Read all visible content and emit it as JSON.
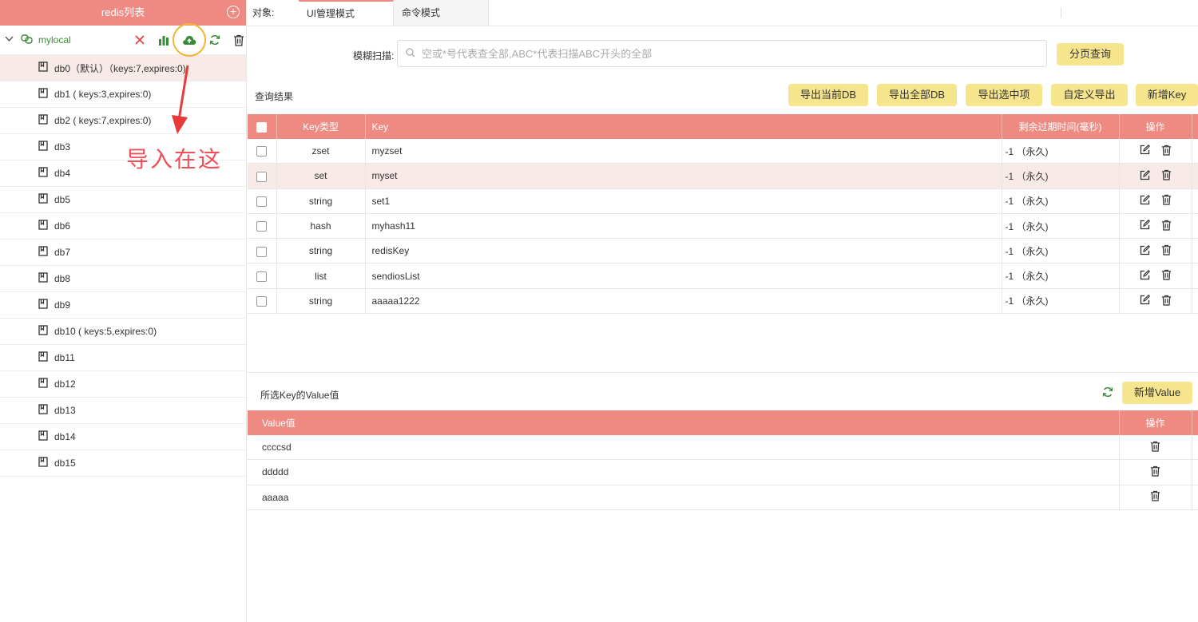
{
  "sidebar": {
    "title": "redis列表",
    "connection": {
      "name": "mylocal"
    },
    "annotation": "导入在这",
    "databases": [
      "db0（默认）（keys:7,expires:0)",
      "db1 ( keys:3,expires:0)",
      "db2 ( keys:7,expires:0)",
      "db3",
      "db4",
      "db5",
      "db6",
      "db7",
      "db8",
      "db9",
      "db10 ( keys:5,expires:0)",
      "db11",
      "db12",
      "db13",
      "db14",
      "db15"
    ]
  },
  "header": {
    "object_label": "对象:",
    "tabs": [
      "UI管理模式",
      "命令模式"
    ]
  },
  "search": {
    "label": "模糊扫描:",
    "placeholder": "空或*号代表查全部,ABC*代表扫描ABC开头的全部",
    "button": "分页查询"
  },
  "results": {
    "title": "查询结果",
    "buttons": [
      "导出当前DB",
      "导出全部DB",
      "导出选中项",
      "自定义导出",
      "新增Key"
    ],
    "columns": [
      "Key类型",
      "Key",
      "剩余过期时间(毫秒)",
      "操作"
    ],
    "rows": [
      {
        "type": "zset",
        "key": "myzset",
        "ttl": "-1 （永久)"
      },
      {
        "type": "set",
        "key": "myset",
        "ttl": "-1 （永久)"
      },
      {
        "type": "string",
        "key": "set1",
        "ttl": "-1 （永久)"
      },
      {
        "type": "hash",
        "key": "myhash11",
        "ttl": "-1 （永久)"
      },
      {
        "type": "string",
        "key": "redisKey",
        "ttl": "-1 （永久)"
      },
      {
        "type": "list",
        "key": "sendiosList",
        "ttl": "-1 （永久)"
      },
      {
        "type": "string",
        "key": "aaaaa1222",
        "ttl": "-1 （永久)"
      }
    ]
  },
  "values": {
    "title": "所选Key的Value值",
    "add_button": "新增Value",
    "columns": [
      "Value值",
      "操作"
    ],
    "rows": [
      "ccccsd",
      "ddddd",
      "aaaaa"
    ]
  },
  "colors": {
    "accent": "#ef8a82",
    "button": "#f6e58d",
    "highlight_row": "#f8ebe7",
    "annotation": "#f0505a",
    "success": "#3a8a3a"
  }
}
